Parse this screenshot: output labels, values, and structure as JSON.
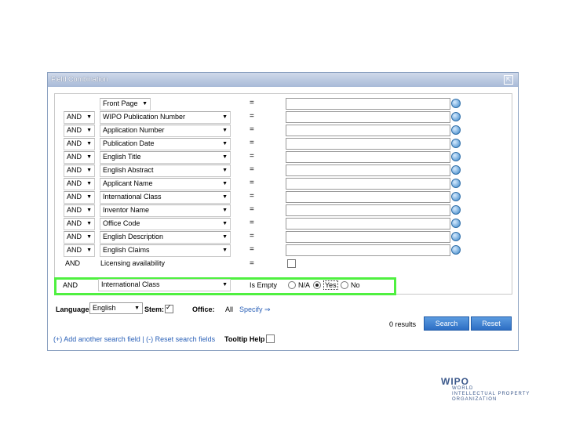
{
  "panel": {
    "title": "Field Combination",
    "popout_icon": "external-window-icon"
  },
  "front_page": {
    "label": "Front Page",
    "eq": "="
  },
  "rows": [
    {
      "op": "AND",
      "field": "WIPO Publication Number",
      "eq": "="
    },
    {
      "op": "AND",
      "field": "Application Number",
      "eq": "="
    },
    {
      "op": "AND",
      "field": "Publication Date",
      "eq": "="
    },
    {
      "op": "AND",
      "field": "English Title",
      "eq": "="
    },
    {
      "op": "AND",
      "field": "English Abstract",
      "eq": "="
    },
    {
      "op": "AND",
      "field": "Applicant Name",
      "eq": "="
    },
    {
      "op": "AND",
      "field": "International Class",
      "eq": "="
    },
    {
      "op": "AND",
      "field": "Inventor Name",
      "eq": "="
    },
    {
      "op": "AND",
      "field": "Office Code",
      "eq": "="
    },
    {
      "op": "AND",
      "field": "English Description",
      "eq": "="
    },
    {
      "op": "AND",
      "field": "English Claims",
      "eq": "="
    }
  ],
  "licensing": {
    "op": "AND",
    "label": "Licensing availability",
    "eq": "="
  },
  "highlight_row": {
    "op": "AND",
    "field": "International Class",
    "condition": "Is Empty",
    "options": [
      "N/A",
      "Yes",
      "No"
    ],
    "selected": "Yes",
    "color": "#4ff040"
  },
  "bottom": {
    "language_label": "Language",
    "language_value": "English",
    "stem_label": "Stem:",
    "office_label": "Office:",
    "office_value": "All",
    "office_specify": "Specify ⇒",
    "results_text": "0 results",
    "search_button": "Search",
    "reset_button": "Reset",
    "add_reset_links": "(+) Add another search field | (-) Reset search fields",
    "tooltip_label": "Tooltip Help"
  },
  "logo": {
    "name": "WIPO",
    "line1": "WORLD",
    "line2": "INTELLECTUAL PROPERTY",
    "line3": "ORGANIZATION"
  }
}
